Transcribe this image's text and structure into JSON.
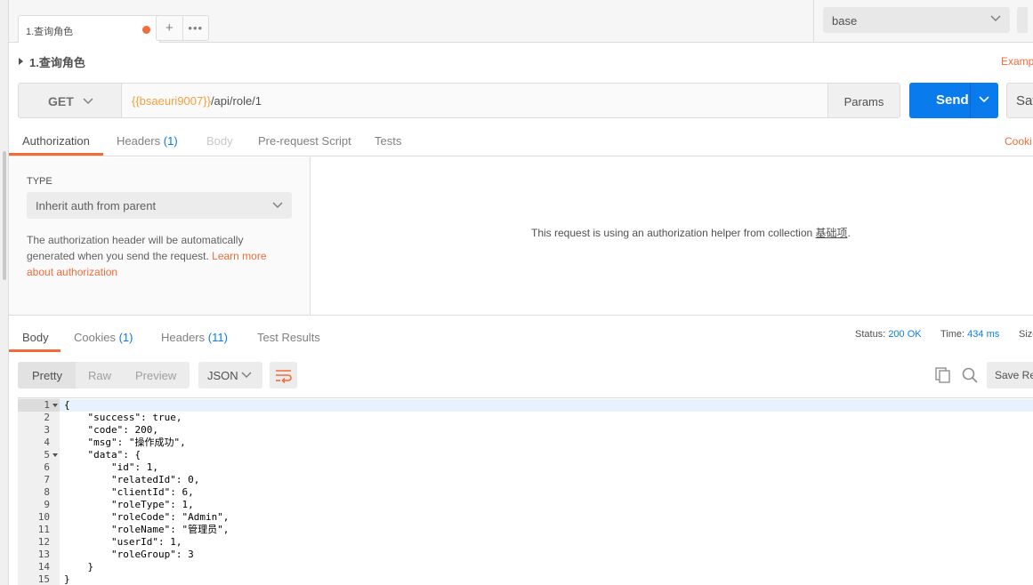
{
  "tab": {
    "label": "1.查询角色"
  },
  "environment": {
    "selected": "base"
  },
  "request": {
    "name": "1.查询角色",
    "examples_label": "Examp",
    "method": "GET",
    "url_variable": "{{bsaeuri9007}}",
    "url_path": "/api/role/1",
    "params_label": "Params",
    "send_label": "Send",
    "save_label": "Sav"
  },
  "request_tabs": [
    {
      "label": "Authorization",
      "count": ""
    },
    {
      "label": "Headers",
      "count": "(1)"
    },
    {
      "label": "Body",
      "count": ""
    },
    {
      "label": "Pre-request Script",
      "count": ""
    },
    {
      "label": "Tests",
      "count": ""
    }
  ],
  "cookies_link": "Cooki",
  "auth": {
    "type_label": "TYPE",
    "type_value": "Inherit auth from parent",
    "description": "The authorization header will be automatically generated when you send the request. ",
    "learn_more": "Learn more about authorization",
    "helper_message_prefix": "This request is using an authorization helper from collection ",
    "helper_collection": "基础项",
    "helper_message_suffix": "."
  },
  "response_tabs": [
    {
      "label": "Body",
      "count": ""
    },
    {
      "label": "Cookies",
      "count": "(1)"
    },
    {
      "label": "Headers",
      "count": "(11)"
    },
    {
      "label": "Test Results",
      "count": ""
    }
  ],
  "response_status": {
    "status_label": "Status:",
    "status_value": "200 OK",
    "time_label": "Time:",
    "time_value": "434 ms",
    "size_label": "Size"
  },
  "response_toolbar": {
    "formats": [
      "Pretty",
      "Raw",
      "Preview"
    ],
    "language": "JSON",
    "save_label": "Save Re"
  },
  "code_lines": [
    {
      "n": "1",
      "text": "{"
    },
    {
      "n": "2",
      "text": "    \"success\": true,"
    },
    {
      "n": "3",
      "text": "    \"code\": 200,"
    },
    {
      "n": "4",
      "text": "    \"msg\": \"操作成功\","
    },
    {
      "n": "5",
      "text": "    \"data\": {"
    },
    {
      "n": "6",
      "text": "        \"id\": 1,"
    },
    {
      "n": "7",
      "text": "        \"relatedId\": 0,"
    },
    {
      "n": "8",
      "text": "        \"clientId\": 6,"
    },
    {
      "n": "9",
      "text": "        \"roleType\": 1,"
    },
    {
      "n": "10",
      "text": "        \"roleCode\": \"Admin\","
    },
    {
      "n": "11",
      "text": "        \"roleName\": \"管理员\","
    },
    {
      "n": "12",
      "text": "        \"userId\": 1,"
    },
    {
      "n": "13",
      "text": "        \"roleGroup\": 3"
    },
    {
      "n": "14",
      "text": "    }"
    },
    {
      "n": "15",
      "text": "}"
    }
  ]
}
